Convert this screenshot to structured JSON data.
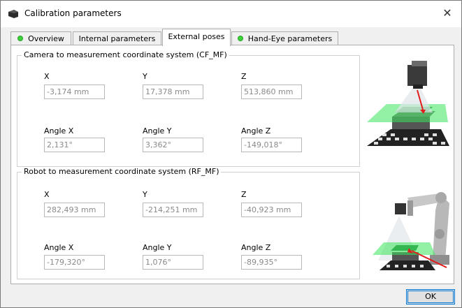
{
  "window": {
    "title": "Calibration parameters",
    "close_glyph": "✕"
  },
  "tabs": [
    {
      "label": "Overview",
      "has_status_dot": true
    },
    {
      "label": "Internal parameters",
      "has_status_dot": false
    },
    {
      "label": "External poses",
      "has_status_dot": false,
      "active": true
    },
    {
      "label": "Hand-Eye parameters",
      "has_status_dot": true
    }
  ],
  "camera_group": {
    "title": "Camera to measurement coordinate system (CF_MF)",
    "x_label": "X",
    "x_value": "-3,174 mm",
    "y_label": "Y",
    "y_value": "17,378 mm",
    "z_label": "Z",
    "z_value": "513,860 mm",
    "ax_label": "Angle X",
    "ax_value": "2,131°",
    "ay_label": "Angle Y",
    "ay_value": "3,362°",
    "az_label": "Angle Z",
    "az_value": "-149,018°"
  },
  "robot_group": {
    "title": "Robot to measurement coordinate system (RF_MF)",
    "x_label": "X",
    "x_value": "282,493 mm",
    "y_label": "Y",
    "y_value": "-214,251 mm",
    "z_label": "Z",
    "z_value": "-40,923 mm",
    "ax_label": "Angle X",
    "ax_value": "-179,320°",
    "ay_label": "Angle Y",
    "ay_value": "1,076°",
    "az_label": "Angle Z",
    "az_value": "-89,935°"
  },
  "footer": {
    "ok_label": "OK"
  },
  "colors": {
    "status_dot": "#3cd23c",
    "plane_green": "#39e65a",
    "arrow_red": "#e21b1b",
    "focus_blue": "#0078d7"
  }
}
